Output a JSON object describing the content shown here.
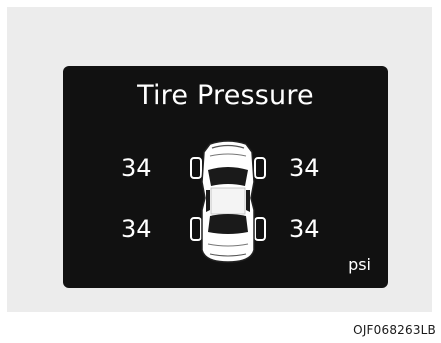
{
  "display": {
    "title": "Tire Pressure",
    "tires": {
      "front_left": "34",
      "front_right": "34",
      "rear_left": "34",
      "rear_right": "34"
    },
    "unit": "psi"
  },
  "image_code": "OJF068263LB",
  "colors": {
    "screen_background": "#111111",
    "text": "#ffffff",
    "panel_background": "#ececec"
  },
  "icons": {
    "car": "car-top-view-icon"
  }
}
